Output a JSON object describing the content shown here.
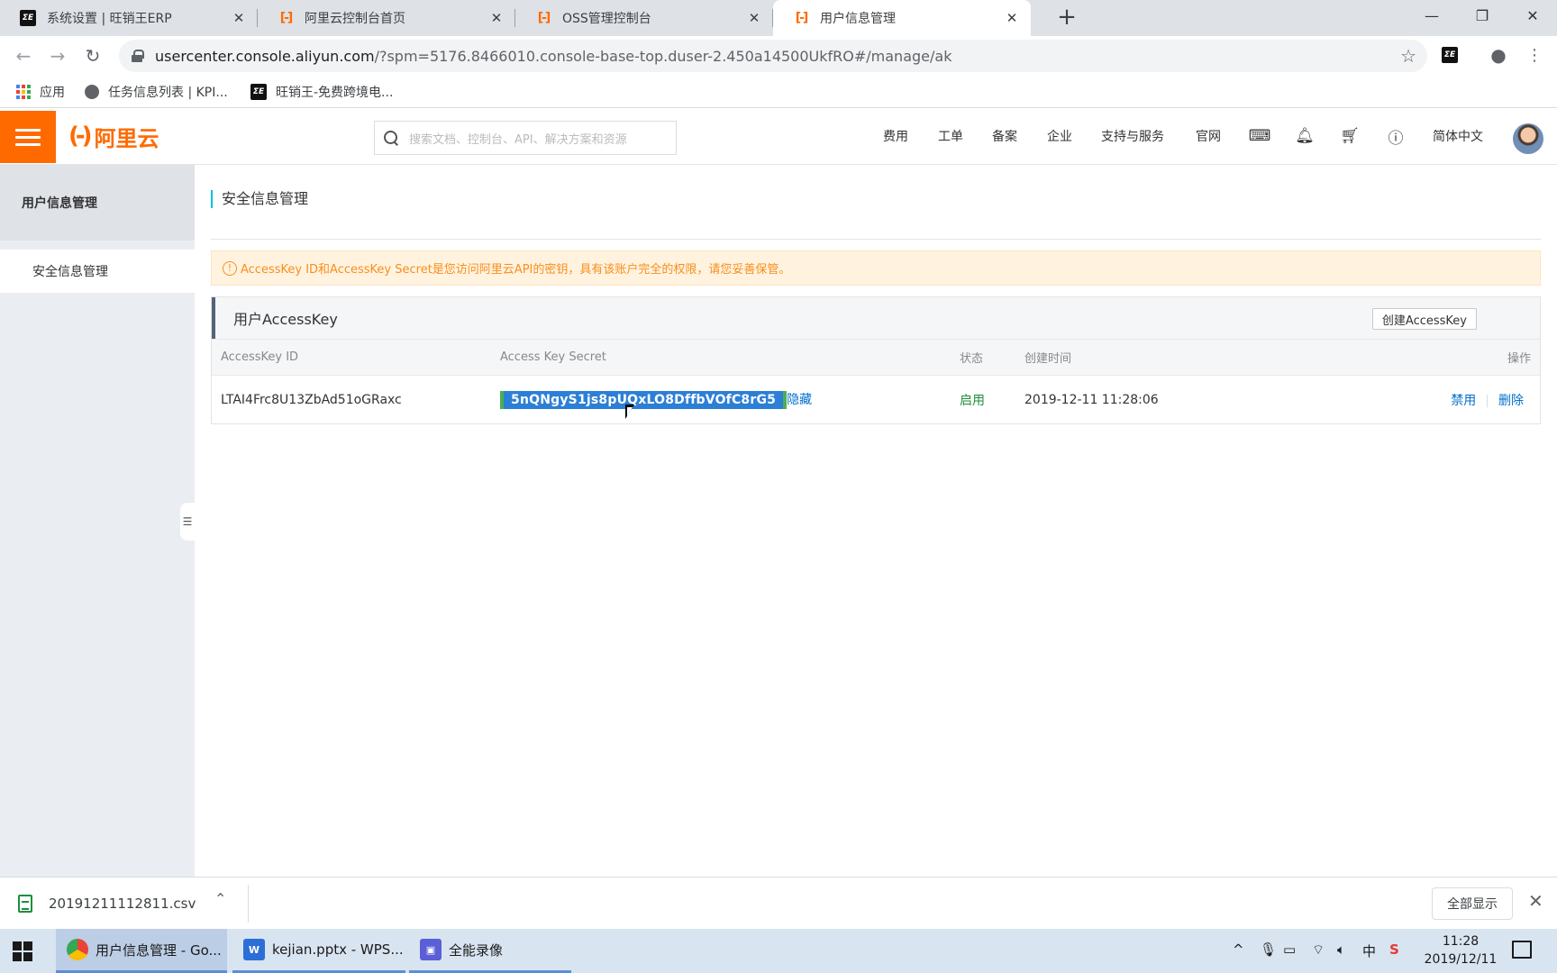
{
  "browser": {
    "tabs": [
      {
        "title": "系统设置 | 旺销王ERP",
        "icon": "erp-favicon"
      },
      {
        "title": "阿里云控制台首页",
        "icon": "aliyun-favicon"
      },
      {
        "title": "OSS管理控制台",
        "icon": "aliyun-favicon"
      },
      {
        "title": "用户信息管理",
        "icon": "aliyun-favicon",
        "active": true
      }
    ],
    "url_host": "usercenter.console.aliyun.com",
    "url_rest": "/?spm=5176.8466010.console-base-top.duser-2.450a14500UkfRO#/manage/ak",
    "bookmarks": [
      "应用",
      "任务信息列表 | KPI...",
      "旺销王-免费跨境电..."
    ]
  },
  "console": {
    "logo_text": "阿里云",
    "search_placeholder": "搜索文档、控制台、API、解决方案和资源",
    "nav_links": [
      "费用",
      "工单",
      "备案",
      "企业",
      "支持与服务",
      "官网"
    ],
    "language": "简体中文",
    "accent_color": "#ff6a00"
  },
  "sidebar": {
    "header": "用户信息管理",
    "items": [
      {
        "label": "安全信息管理",
        "active": true
      }
    ]
  },
  "main": {
    "page_title": "安全信息管理",
    "notice": "AccessKey ID和AccessKey Secret是您访问阿里云API的密钥，具有该账户完全的权限，请您妥善保管。",
    "panel_title": "用户AccessKey",
    "create_button": "创建AccessKey",
    "columns": [
      "AccessKey ID",
      "Access Key Secret",
      "状态",
      "创建时间",
      "操作"
    ],
    "rows": [
      {
        "access_key_id": "LTAI4Frc8U13ZbAd51oGRaxc",
        "access_key_secret": "5nQNgyS1js8pUQxLO8DffbVOfC8rG5",
        "hide_label": "隐藏",
        "status": "启用",
        "created": "2019-12-11 11:28:06",
        "actions": [
          "禁用",
          "删除"
        ]
      }
    ]
  },
  "download_bar": {
    "file_name": "20191211112811.csv",
    "show_all": "全部显示"
  },
  "taskbar": {
    "tasks": [
      {
        "label": "用户信息管理 - Go...",
        "icon": "chrome-icon"
      },
      {
        "label": "kejian.pptx - WPS...",
        "icon": "wps-icon"
      },
      {
        "label": "全能录像",
        "icon": "recorder-icon"
      }
    ],
    "ime": "中",
    "time": "11:28",
    "date": "2019/12/11"
  }
}
